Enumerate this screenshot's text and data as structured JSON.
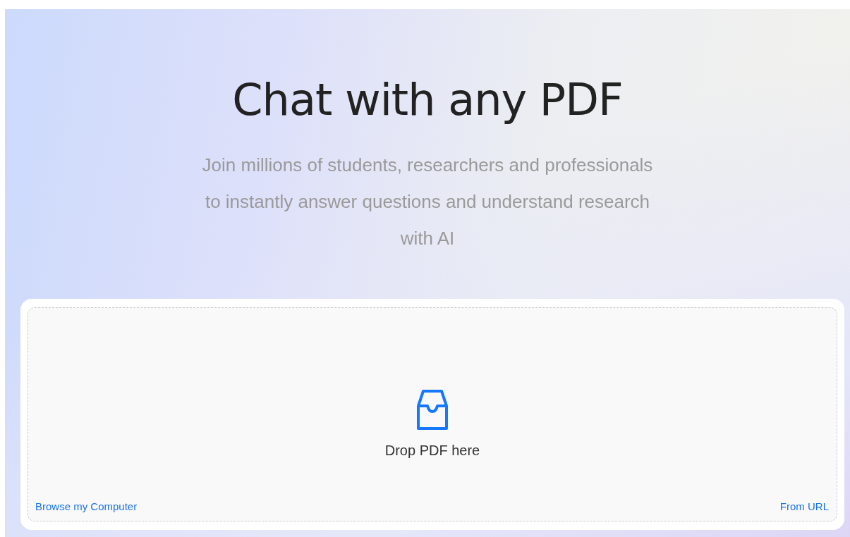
{
  "hero": {
    "title": "Chat with any PDF",
    "subtitle": "Join millions of students, researchers and professionals to instantly answer questions and understand research with AI"
  },
  "upload": {
    "prompt": "Drop PDF here",
    "links": [
      {
        "label": "Browse my Computer"
      },
      {
        "label": "From URL"
      }
    ]
  }
}
